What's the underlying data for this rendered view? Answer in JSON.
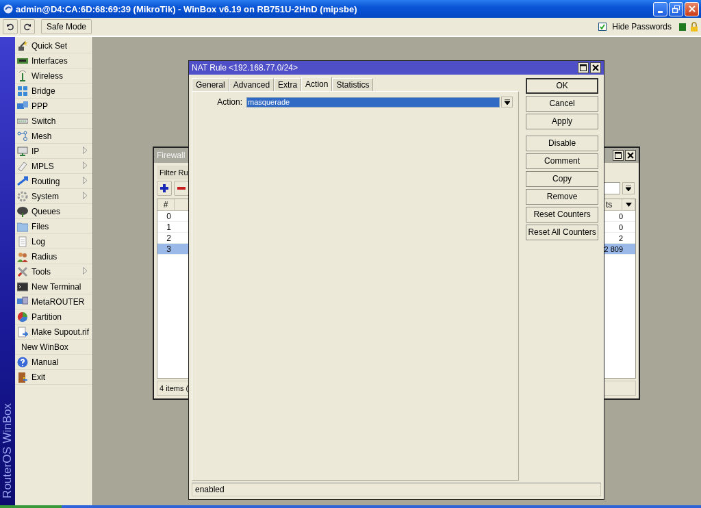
{
  "window": {
    "title": "admin@D4:CA:6D:68:69:39 (MikroTik) - WinBox v6.19 on RB751U-2HnD (mipsbe)"
  },
  "toolbar": {
    "safe_mode": "Safe Mode",
    "hide_passwords": {
      "label": "Hide Passwords",
      "checked": true
    }
  },
  "sidebar": {
    "brand": "RouterOS WinBox",
    "items": [
      {
        "label": "Quick Set",
        "kind": "icon",
        "submenu": false
      },
      {
        "label": "Interfaces",
        "kind": "icon",
        "submenu": false
      },
      {
        "label": "Wireless",
        "kind": "icon",
        "submenu": false
      },
      {
        "label": "Bridge",
        "kind": "icon",
        "submenu": false
      },
      {
        "label": "PPP",
        "kind": "icon",
        "submenu": false
      },
      {
        "label": "Switch",
        "kind": "icon",
        "submenu": false
      },
      {
        "label": "Mesh",
        "kind": "icon",
        "submenu": false
      },
      {
        "label": "IP",
        "kind": "icon",
        "submenu": true
      },
      {
        "label": "MPLS",
        "kind": "icon",
        "submenu": true
      },
      {
        "label": "Routing",
        "kind": "icon",
        "submenu": true
      },
      {
        "label": "System",
        "kind": "icon",
        "submenu": true
      },
      {
        "label": "Queues",
        "kind": "icon",
        "submenu": false
      },
      {
        "label": "Files",
        "kind": "icon",
        "submenu": false
      },
      {
        "label": "Log",
        "kind": "icon",
        "submenu": false
      },
      {
        "label": "Radius",
        "kind": "icon",
        "submenu": false
      },
      {
        "label": "Tools",
        "kind": "icon",
        "submenu": true
      },
      {
        "label": "New Terminal",
        "kind": "icon",
        "submenu": false
      },
      {
        "label": "MetaROUTER",
        "kind": "icon",
        "submenu": false
      },
      {
        "label": "Partition",
        "kind": "icon",
        "submenu": false
      },
      {
        "label": "Make Supout.rif",
        "kind": "icon",
        "submenu": false
      },
      {
        "label": "New WinBox",
        "kind": "plain",
        "submenu": false
      },
      {
        "label": "Manual",
        "kind": "icon",
        "submenu": false
      },
      {
        "label": "Exit",
        "kind": "icon",
        "submenu": false
      }
    ]
  },
  "firewall_window": {
    "title": "Firewall",
    "tab": "Filter Ru",
    "columns": [
      "#",
      "ts"
    ],
    "rows": [
      {
        "number": "0",
        "column_2": "0",
        "selected": false
      },
      {
        "number": "1",
        "column_2": "0",
        "selected": false
      },
      {
        "number": "2",
        "column_2": "2",
        "selected": false
      },
      {
        "number": "3",
        "column_2": "2 809",
        "selected": true
      }
    ],
    "status": "4 items ("
  },
  "nat_rule_window": {
    "title": "NAT Rule <192.168.77.0/24>",
    "tabs": [
      {
        "label": "General",
        "selected": false
      },
      {
        "label": "Advanced",
        "selected": false
      },
      {
        "label": "Extra",
        "selected": false
      },
      {
        "label": "Action",
        "selected": true
      },
      {
        "label": "Statistics",
        "selected": false
      }
    ],
    "fields": [
      {
        "label": "Action:",
        "value": "masquerade",
        "value_selected": true
      }
    ],
    "button_groups": [
      [
        {
          "label": "OK",
          "default": true
        },
        {
          "label": "Cancel",
          "default": false
        },
        {
          "label": "Apply",
          "default": false
        }
      ],
      [
        {
          "label": "Disable",
          "default": false
        },
        {
          "label": "Comment",
          "default": false
        },
        {
          "label": "Copy",
          "default": false
        },
        {
          "label": "Remove",
          "default": false
        },
        {
          "label": "Reset Counters",
          "default": false
        },
        {
          "label": "Reset All Counters",
          "default": false
        }
      ]
    ],
    "status": "enabled"
  }
}
